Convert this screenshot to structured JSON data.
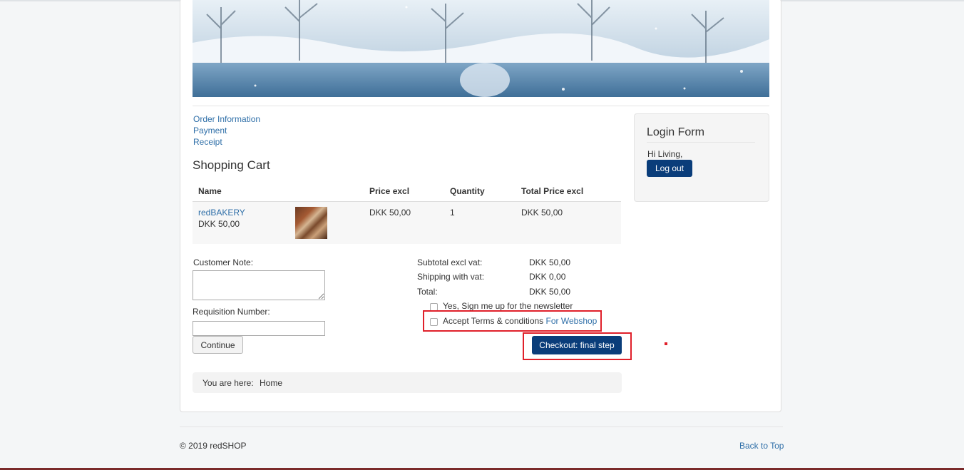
{
  "checkout_steps": [
    "Order Information",
    "Payment",
    "Receipt"
  ],
  "cart": {
    "title": "Shopping Cart",
    "headers": [
      "Name",
      "Price excl",
      "Quantity",
      "Total Price excl"
    ],
    "item": {
      "name": "redBAKERY",
      "price_line": "DKK 50,00",
      "price": "DKK 50,00",
      "quantity": "1",
      "total": "DKK 50,00"
    }
  },
  "form": {
    "customer_note_label": "Customer Note:",
    "customer_note_value": "",
    "requisition_label": "Requisition Number:",
    "requisition_value": "",
    "continue_label": "Continue"
  },
  "totals": {
    "subtotal_label": "Subtotal excl vat:",
    "subtotal_value": "DKK 50,00",
    "shipping_label": "Shipping with vat:",
    "shipping_value": "DKK 0,00",
    "total_label": "Total:",
    "total_value": "DKK 50,00"
  },
  "options": {
    "newsletter_label": "Yes, Sign me up for the newsletter",
    "terms_label": "Accept Terms & conditions",
    "terms_link": "For Webshop"
  },
  "checkout_button": "Checkout: final step",
  "breadcrumb": {
    "prefix": "You are here:",
    "home": "Home"
  },
  "login": {
    "title": "Login Form",
    "greeting": "Hi Living,",
    "logout": "Log out"
  },
  "footer": {
    "copyright": "© 2019 redSHOP",
    "back_to_top": "Back to Top"
  },
  "colors": {
    "link": "#2f6fa8",
    "primary_button": "#0a3d7a",
    "highlight": "#e0202a"
  }
}
